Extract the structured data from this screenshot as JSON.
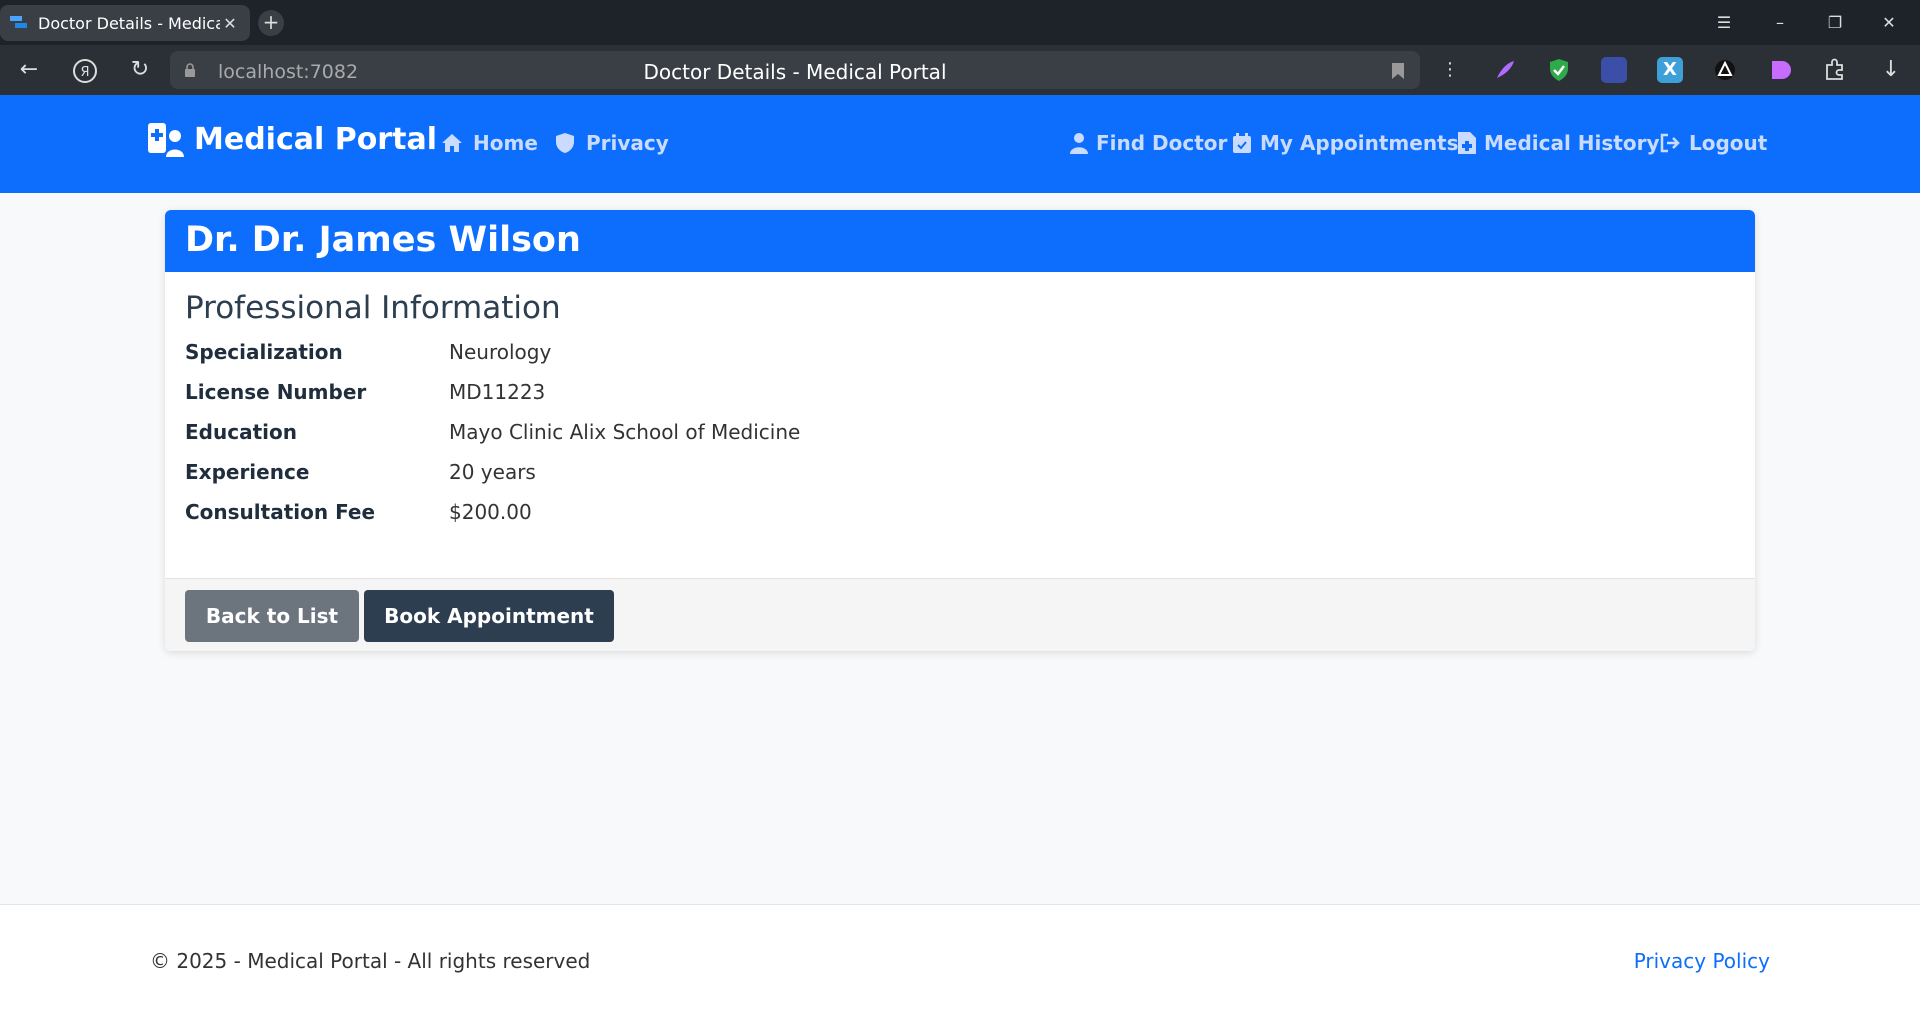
{
  "browser": {
    "tab_title": "Doctor Details - Medical Portal",
    "url": "localhost:7082",
    "page_title": "Doctor Details - Medical Portal"
  },
  "header": {
    "brand": "Medical Portal",
    "nav_left": [
      {
        "label": "Home",
        "icon": "home-icon"
      },
      {
        "label": "Privacy",
        "icon": "shield-icon"
      }
    ],
    "nav_right": [
      {
        "label": "Find Doctor",
        "icon": "user-doctor-icon"
      },
      {
        "label": "My Appointments",
        "icon": "calendar-icon"
      },
      {
        "label": "Medical History",
        "icon": "file-medical-icon"
      },
      {
        "label": "Logout",
        "icon": "logout-icon"
      }
    ]
  },
  "card": {
    "title": "Dr. Dr. James Wilson",
    "section_title": "Professional Information",
    "fields": [
      {
        "label": "Specialization",
        "value": "Neurology"
      },
      {
        "label": "License Number",
        "value": "MD11223"
      },
      {
        "label": "Education",
        "value": "Mayo Clinic Alix School of Medicine"
      },
      {
        "label": "Experience",
        "value": "20 years"
      },
      {
        "label": "Consultation Fee",
        "value": "$200.00"
      }
    ],
    "back_label": "Back to List",
    "book_label": "Book Appointment"
  },
  "footer": {
    "copyright": "© 2025 - Medical Portal - All rights reserved",
    "privacy_link": "Privacy Policy"
  },
  "colors": {
    "primary": "#0d6efd",
    "dark_button": "#2c3e50",
    "secondary_button": "#6c757d"
  }
}
